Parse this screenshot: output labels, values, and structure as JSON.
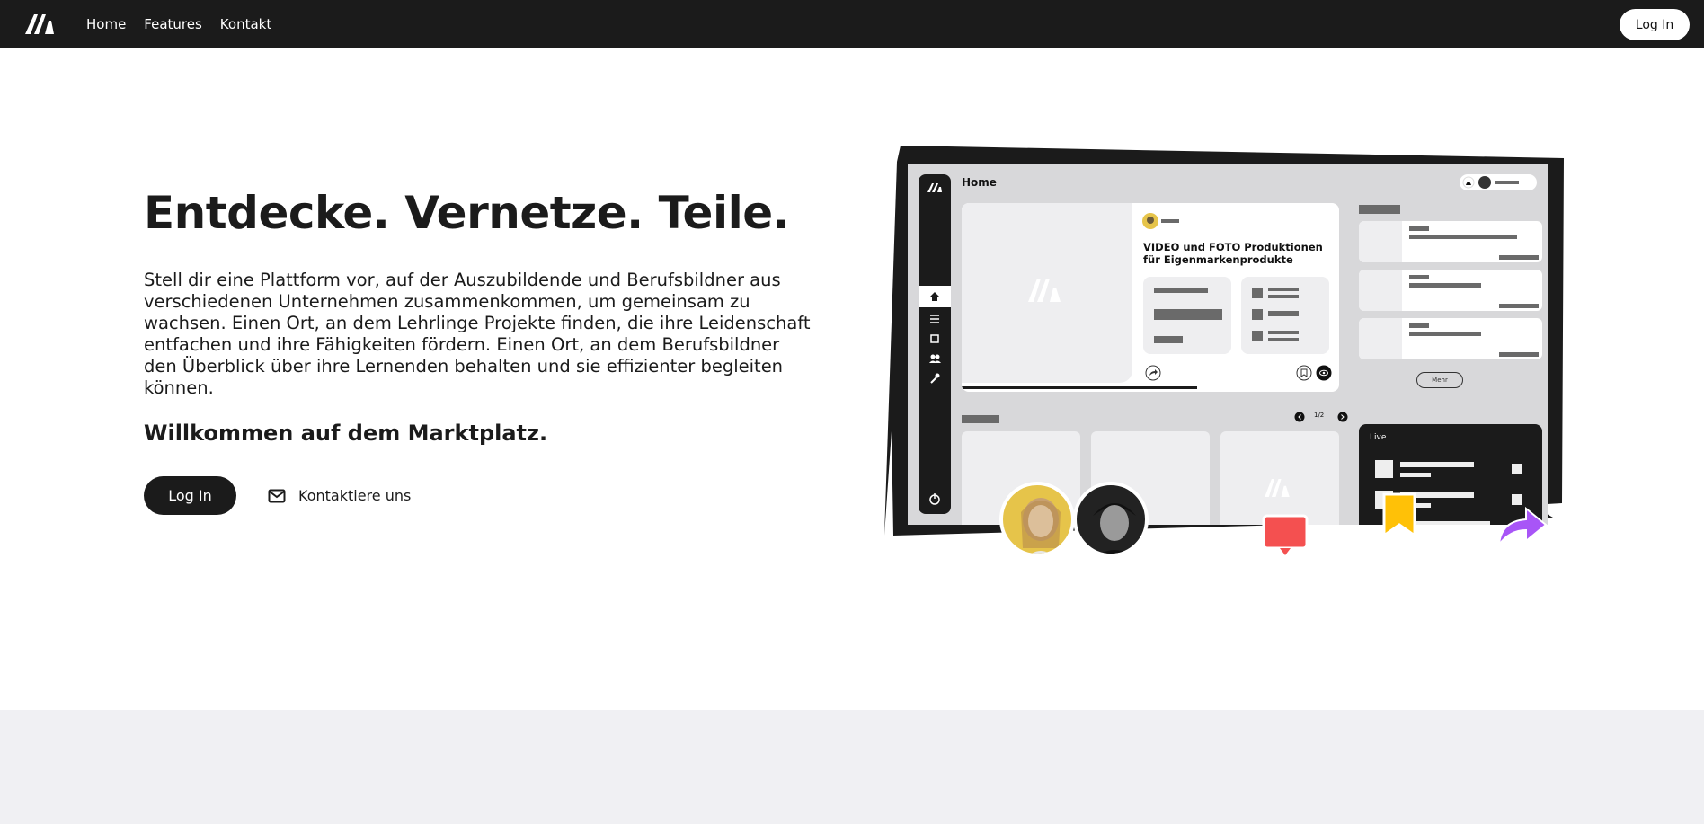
{
  "nav": {
    "links": [
      "Home",
      "Features",
      "Kontakt"
    ],
    "login_label": "Log In"
  },
  "hero": {
    "title": "Entdecke. Vernetze. Teile.",
    "text": "Stell dir eine Plattform vor, auf der Auszubildende und Berufsbildner aus verschiedenen Unternehmen zusammenkommen, um gemeinsam zu wachsen. Einen Ort, an dem Lehrlinge Projekte finden, die ihre Leidenschaft entfachen und ihre Fähigkeiten fördern. Einen Ort, an dem Berufsbildner den Überblick über ihre Lernenden behalten und sie effizienter begleiten können.",
    "subtitle": "Willkommen auf dem Marktplatz.",
    "login_label": "Log In",
    "contact_label": "Kontaktiere uns"
  },
  "mockup": {
    "page_title": "Home",
    "card_title": "VIDEO und FOTO Produktionen für Eigenmarkenprodukte",
    "more_label": "Mehr",
    "pager": "1/2",
    "live_label": "Live"
  },
  "colors": {
    "dark": "#1b1b1b",
    "footer_band": "#f0f0f3",
    "chat_icon": "#f45050",
    "bookmark_icon": "#ffc107",
    "share_icon": "#a855f7",
    "avatar_left_bg": "#e6c44a"
  }
}
